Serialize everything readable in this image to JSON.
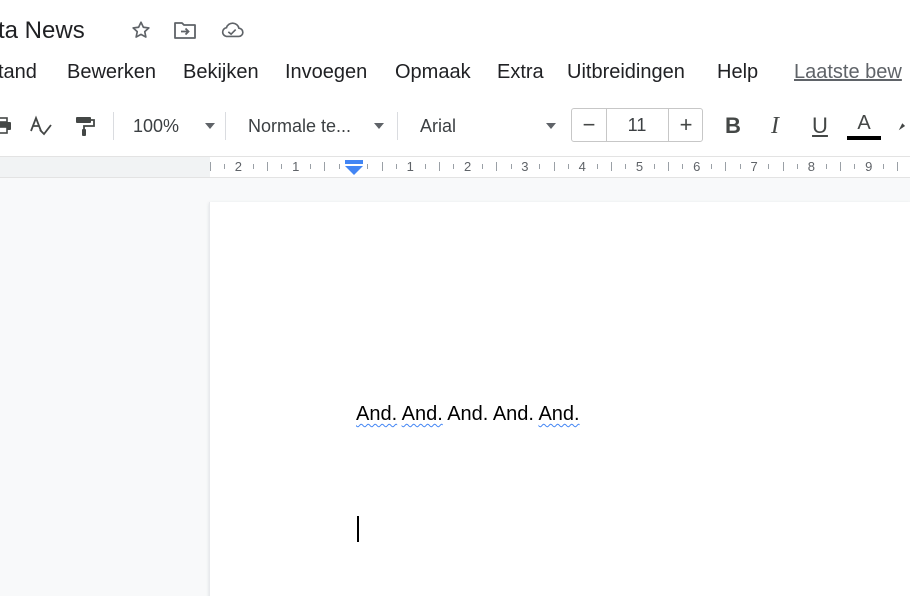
{
  "document": {
    "title": "ta News"
  },
  "title_icons": [
    "star-icon",
    "move-to-folder-icon",
    "cloud-saved-icon"
  ],
  "menu": {
    "items": [
      "tand",
      "Bewerken",
      "Bekijken",
      "Invoegen",
      "Opmaak",
      "Extra",
      "Uitbreidingen",
      "Help"
    ],
    "last_edit": "Laatste bew"
  },
  "toolbar": {
    "zoom": "100%",
    "style": "Normale te...",
    "font": "Arial",
    "font_size": "11",
    "decrease_label": "−",
    "increase_label": "+",
    "bold_label": "B",
    "italic_label": "I",
    "underline_label": "U",
    "text_color_label": "A",
    "text_color": "#000000"
  },
  "ruler": {
    "labels": [
      "2",
      "1",
      "1",
      "2",
      "3",
      "4",
      "5",
      "6",
      "7",
      "8",
      "9"
    ]
  },
  "page": {
    "words": [
      "And.",
      "And.",
      "And.",
      "And.",
      "And."
    ],
    "misspelled": [
      true,
      true,
      false,
      false,
      true
    ]
  },
  "colors": {
    "accent": "#4285f4",
    "text": "#202124"
  }
}
